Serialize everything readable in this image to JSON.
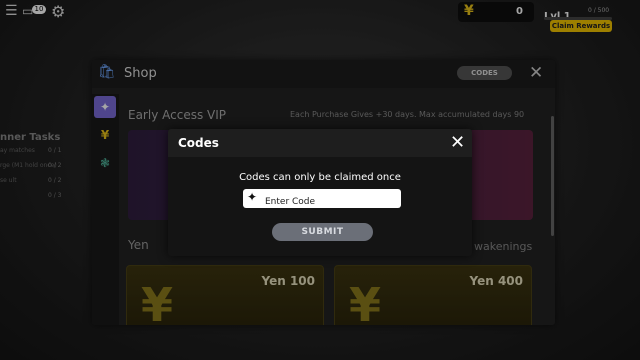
{
  "hud": {
    "chat_badge": "10",
    "currency_amount": "0",
    "level": "Lvl 1",
    "xp": "0 / 500",
    "claim_rewards": "Claim Rewards"
  },
  "tasks": {
    "title": "nner Tasks",
    "rows": [
      {
        "label": "ay matches",
        "value": "0 / 1"
      },
      {
        "label": "rge (M1 hold once)",
        "value": "0 / 2"
      },
      {
        "label": "se ult",
        "value": "0 / 2"
      },
      {
        "label": "",
        "value": "0 / 3"
      }
    ]
  },
  "shop": {
    "title": "Shop",
    "codes_button": "CODES",
    "vip_title": "Early Access VIP",
    "vip_note": "Each Purchase Gives +30 days. Max accumulated days 90",
    "yen_section": "Yen",
    "awakenings_label": "wakenings",
    "yen_cards": [
      {
        "title": "Yen 100"
      },
      {
        "title": "Yen 400"
      }
    ]
  },
  "codes_modal": {
    "title": "Codes",
    "message": "Codes can only be claimed once",
    "input_placeholder": "Enter Code",
    "input_value": "",
    "submit": "SUBMIT"
  },
  "colors": {
    "accent_yellow": "#f2c300",
    "modal_bg": "#141414",
    "submit_bg": "#6b6f78",
    "vip_purple": "#552565"
  }
}
